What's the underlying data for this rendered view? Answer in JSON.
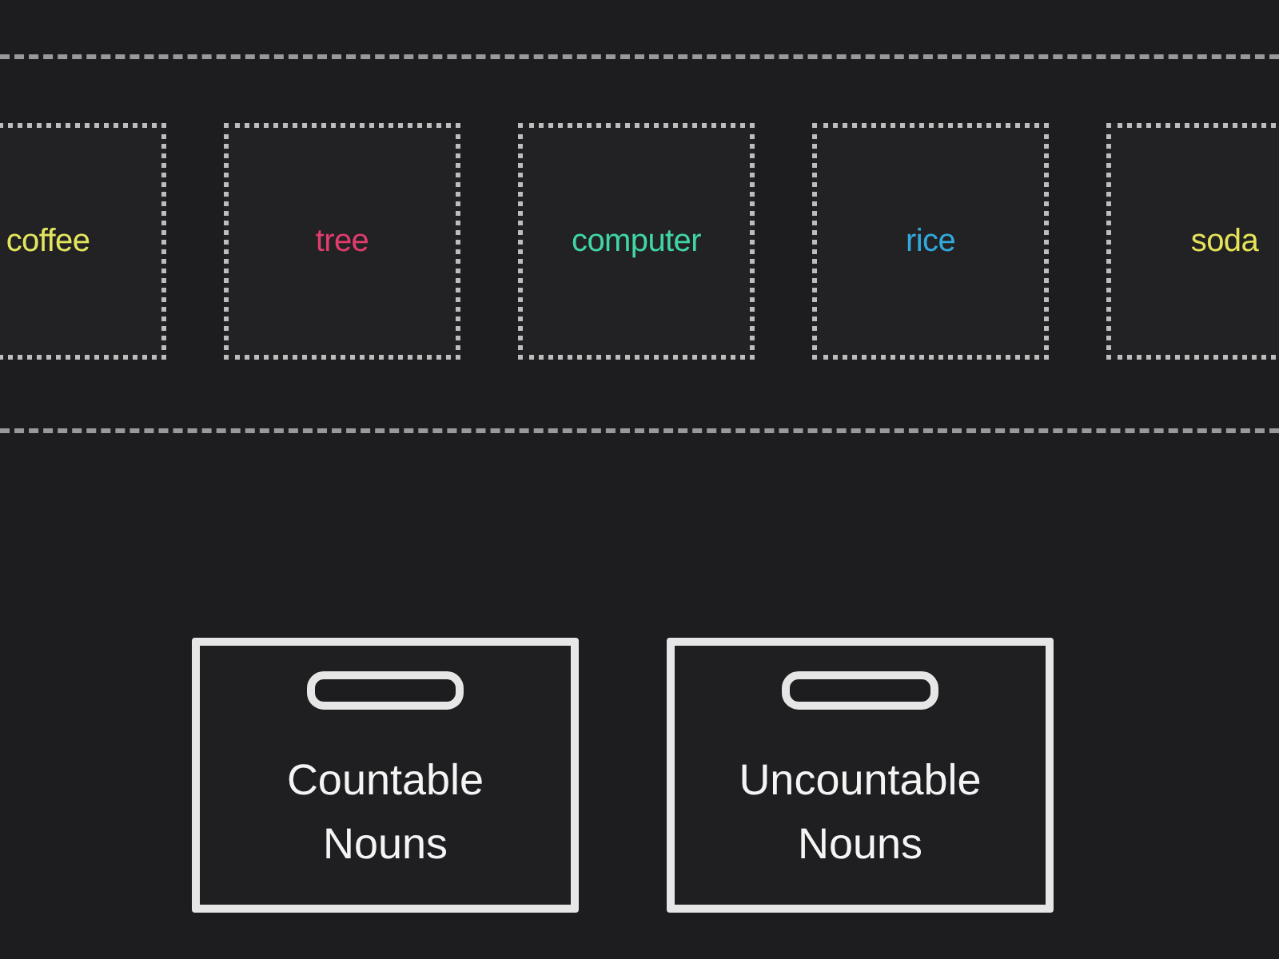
{
  "cards": [
    {
      "text": "coffee",
      "color": "#e2e65e"
    },
    {
      "text": "tree",
      "color": "#e03c6e"
    },
    {
      "text": "computer",
      "color": "#40d6a4"
    },
    {
      "text": "rice",
      "color": "#31a9dc"
    },
    {
      "text": "soda",
      "color": "#e6e35a"
    }
  ],
  "bins": [
    {
      "label": "Countable Nouns"
    },
    {
      "label": "Uncountable Nouns"
    }
  ]
}
